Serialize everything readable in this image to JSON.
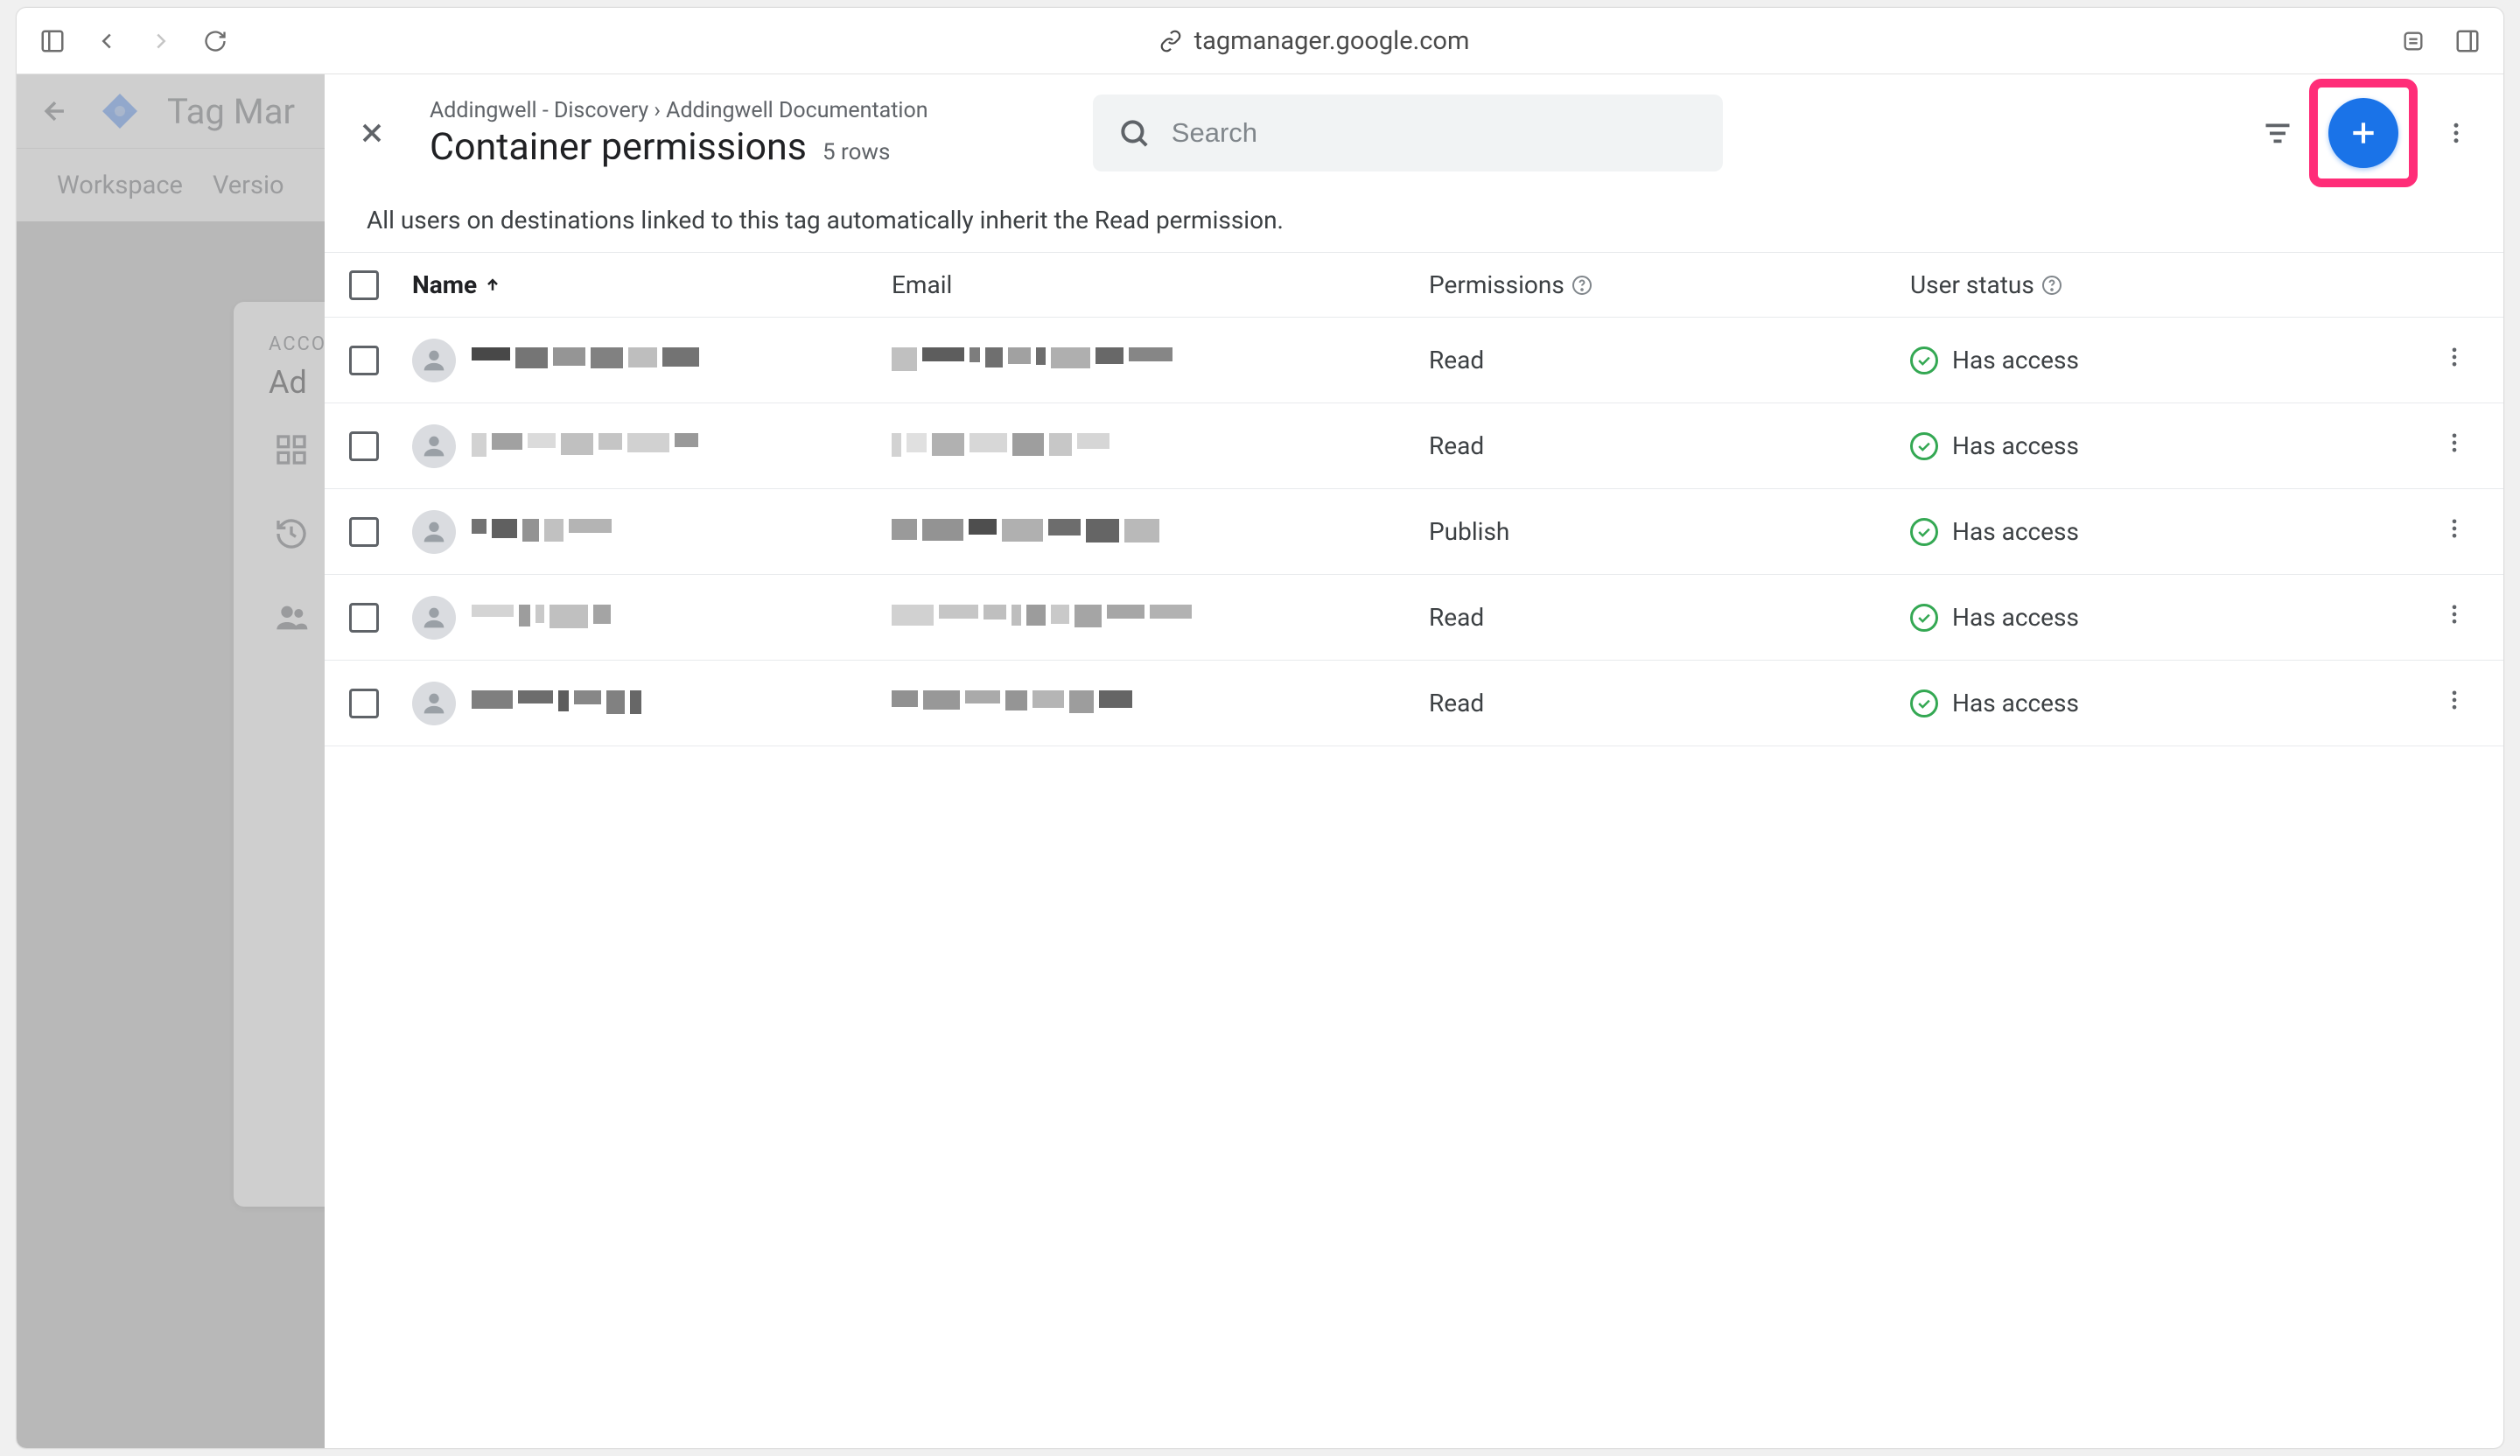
{
  "browser": {
    "url": "tagmanager.google.com"
  },
  "bg_app": {
    "title": "Tag Mar",
    "tabs": [
      "Workspace",
      "Versio"
    ],
    "card_label": "ACCO",
    "card_title": "Ad"
  },
  "modal": {
    "breadcrumb": "Addingwell - Discovery › Addingwell Documentation",
    "title": "Container permissions",
    "row_count": "5 rows",
    "search_placeholder": "Search",
    "info": "All users on destinations linked to this tag automatically inherit the Read permission."
  },
  "columns": {
    "name": "Name",
    "email": "Email",
    "permissions": "Permissions",
    "status": "User status"
  },
  "rows": [
    {
      "permission": "Read",
      "status": "Has access"
    },
    {
      "permission": "Read",
      "status": "Has access"
    },
    {
      "permission": "Publish",
      "status": "Has access"
    },
    {
      "permission": "Read",
      "status": "Has access"
    },
    {
      "permission": "Read",
      "status": "Has access"
    }
  ]
}
